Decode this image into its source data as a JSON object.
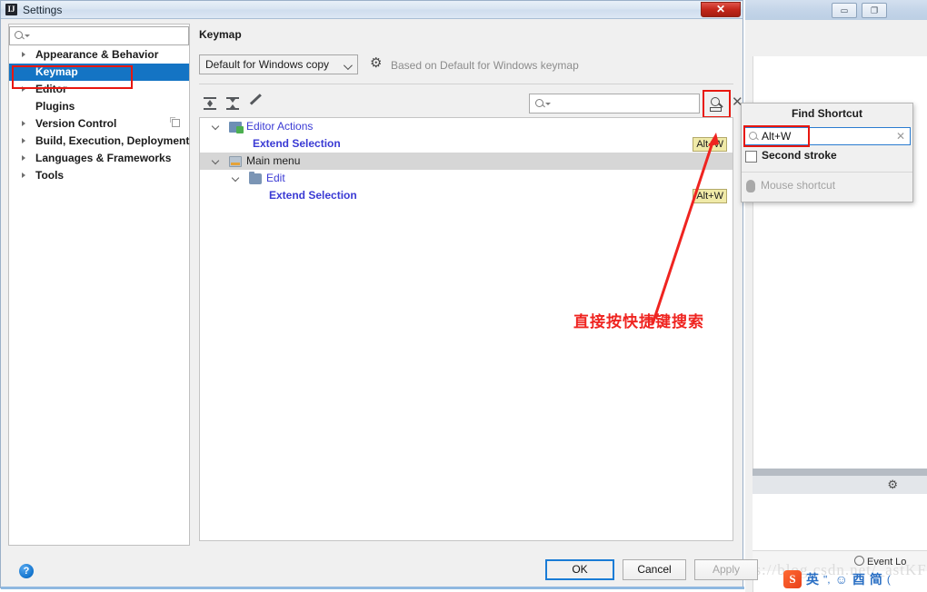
{
  "background_ide": {
    "minimize_glyph": "▭",
    "restore_glyph": "❐",
    "gear_icon": "⚙",
    "status_event_log": "Event Lo",
    "watermark": "https://blog.csdn.net/_astKFIM"
  },
  "ime": {
    "logo_text": "S",
    "items": [
      "英",
      "ʺ,",
      "☺",
      "酉",
      "简",
      "("
    ]
  },
  "dialog": {
    "title": "Settings",
    "icon_text": "IJ",
    "close_label": "✕"
  },
  "sidebar": {
    "search_placeholder": "",
    "items": [
      {
        "label": "Appearance & Behavior",
        "expandable": true,
        "selected": false,
        "sync": false
      },
      {
        "label": "Keymap",
        "expandable": false,
        "selected": true,
        "sync": false
      },
      {
        "label": "Editor",
        "expandable": true,
        "selected": false,
        "sync": false
      },
      {
        "label": "Plugins",
        "expandable": false,
        "selected": false,
        "sync": false
      },
      {
        "label": "Version Control",
        "expandable": true,
        "selected": false,
        "sync": true
      },
      {
        "label": "Build, Execution, Deployment",
        "expandable": true,
        "selected": false,
        "sync": false
      },
      {
        "label": "Languages & Frameworks",
        "expandable": true,
        "selected": false,
        "sync": false
      },
      {
        "label": "Tools",
        "expandable": true,
        "selected": false,
        "sync": false
      }
    ]
  },
  "content": {
    "title": "Keymap",
    "keymap_selected": "Default for Windows copy",
    "gear_icon": "⚙",
    "based_on": "Based on Default for Windows keymap",
    "toolbar": {
      "expand_all_title": "Expand All",
      "collapse_all_title": "Collapse All",
      "edit_title": "Edit Shortcut"
    },
    "tree_search_placeholder": "",
    "close_label": "✕",
    "tree": [
      {
        "label": "Editor Actions",
        "type": "group",
        "indent": 14,
        "icon": "editor-actions",
        "twisty": true,
        "shaded": false,
        "shortcut": ""
      },
      {
        "label": "Extend Selection",
        "type": "leaf",
        "indent": 58,
        "icon": "",
        "twisty": false,
        "shaded": false,
        "shortcut": "Alt+W"
      },
      {
        "label": "Main menu",
        "type": "group",
        "indent": 14,
        "icon": "main-menu",
        "twisty": true,
        "shaded": true,
        "shortcut": ""
      },
      {
        "label": "Edit",
        "type": "folder",
        "indent": 36,
        "icon": "folder",
        "twisty": true,
        "shaded": false,
        "shortcut": ""
      },
      {
        "label": "Extend Selection",
        "type": "leaf",
        "indent": 76,
        "icon": "",
        "twisty": false,
        "shaded": false,
        "shortcut": "Alt+W"
      }
    ]
  },
  "footer": {
    "help_label": "?",
    "ok_label": "OK",
    "cancel_label": "Cancel",
    "apply_label": "Apply"
  },
  "find_popup": {
    "title": "Find Shortcut",
    "value": "Alt+W",
    "clear_label": "✕",
    "second_stroke_label": "Second stroke",
    "second_stroke_checked": false,
    "mouse_shortcut_label": "Mouse shortcut"
  },
  "annotation": {
    "text": "直接按快捷键搜索",
    "color": "#ef2420"
  }
}
